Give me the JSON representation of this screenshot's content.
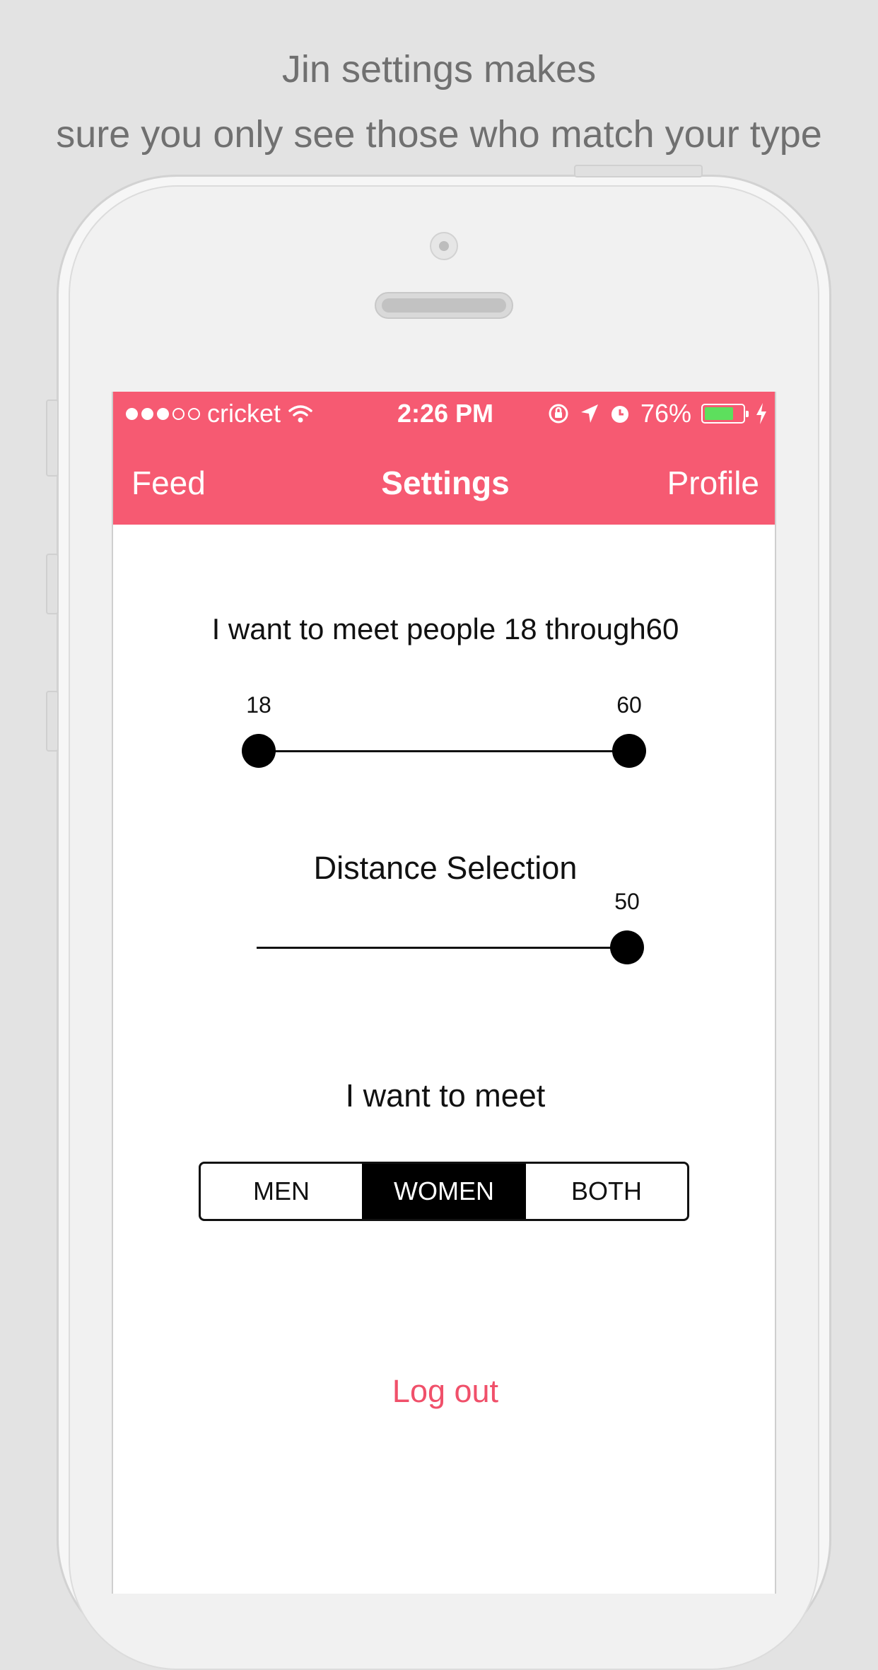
{
  "promo": {
    "line1": "Jin settings makes",
    "line2": "sure you only see those who match your type"
  },
  "status_bar": {
    "carrier": "cricket",
    "signal_bars_filled": 3,
    "signal_bars_total": 5,
    "time": "2:26 PM",
    "battery_percent": "76%",
    "battery_level": 0.76,
    "battery_color": "#5ddf5d"
  },
  "nav": {
    "left": "Feed",
    "title": "Settings",
    "right": "Profile",
    "color": "#f65a72"
  },
  "age": {
    "title": "I want to meet people 18 through60",
    "min_label": "18",
    "max_label": "60"
  },
  "distance": {
    "title": "Distance Selection",
    "value_label": "50"
  },
  "gender": {
    "title": "I want to meet",
    "options": [
      "MEN",
      "WOMEN",
      "BOTH"
    ],
    "selected": "WOMEN"
  },
  "logout": {
    "label": "Log out",
    "color": "#f0506a"
  }
}
